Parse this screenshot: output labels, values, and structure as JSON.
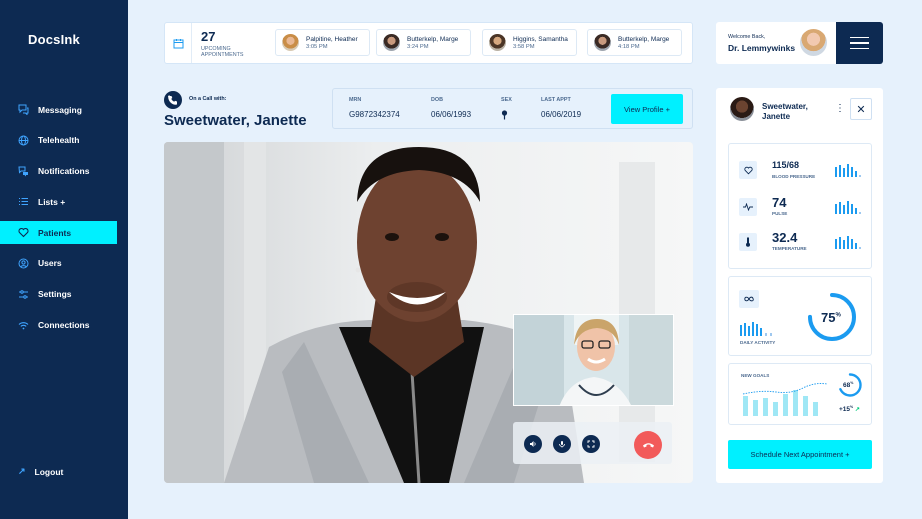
{
  "app": {
    "name": "DocsInk"
  },
  "sidebar": {
    "items": [
      {
        "label": "Messaging",
        "icon": "chat-icon",
        "active": false
      },
      {
        "label": "Telehealth",
        "icon": "globe-icon",
        "active": false
      },
      {
        "label": "Notifications",
        "icon": "bell-chat-icon",
        "active": false
      },
      {
        "label": "Lists +",
        "icon": "list-icon",
        "active": false
      },
      {
        "label": "Patients",
        "icon": "heart-icon",
        "active": true
      },
      {
        "label": "Users",
        "icon": "user-icon",
        "active": false
      },
      {
        "label": "Settings",
        "icon": "sliders-icon",
        "active": false
      },
      {
        "label": "Connections",
        "icon": "wifi-icon",
        "active": false
      }
    ],
    "logout": "Logout"
  },
  "topbar": {
    "upcoming_count": "27",
    "upcoming_label": "UPCOMING APPOINTMENTS",
    "appointments": [
      {
        "name": "Palpitine, Heather",
        "time": "3:05 PM"
      },
      {
        "name": "Butterkelp, Marge",
        "time": "3:24 PM"
      },
      {
        "name": "Higgins, Samantha",
        "time": "3:58 PM"
      },
      {
        "name": "Butterkelp, Marge",
        "time": "4:18 PM"
      }
    ]
  },
  "welcome": {
    "greeting": "Welcome Back,",
    "user": "Dr. Lemmywinks"
  },
  "call": {
    "on_call_label": "On a Call with:",
    "patient_name": "Sweetwater, Janette",
    "mrn_label": "MRN",
    "mrn": "G9872342374",
    "dob_label": "DOB",
    "dob": "06/06/1993",
    "sex_label": "SEX",
    "last_appt_label": "LAST APPT",
    "last_appt": "06/06/2019",
    "view_profile": "View Profile +"
  },
  "patient_panel": {
    "name_line1": "Sweetwater,",
    "name_line2": "Janette",
    "vitals": [
      {
        "value": "115/68",
        "label": "BLOOD PRESSURE",
        "icon": "heart-icon"
      },
      {
        "value": "74",
        "label": "PULSE",
        "icon": "pulse-icon"
      },
      {
        "value": "32.4",
        "label": "TEMPERATURE",
        "icon": "thermometer-icon"
      }
    ],
    "activity": {
      "label": "DAILY ACTIVITY",
      "percent_value": "75",
      "percent_sign": "%",
      "progress": 0.75
    },
    "goals": {
      "label": "NEW GOALS",
      "percent_value": "68",
      "percent_sign": "%",
      "progress": 0.68,
      "delta_value": "+15",
      "delta_sign": "%"
    },
    "schedule_button": "Schedule Next Appointment +"
  },
  "colors": {
    "navy": "#0d2a52",
    "cyan": "#00f0ff",
    "blue": "#1b9bf0",
    "red": "#f25a5a",
    "background": "#e6f1fc"
  }
}
